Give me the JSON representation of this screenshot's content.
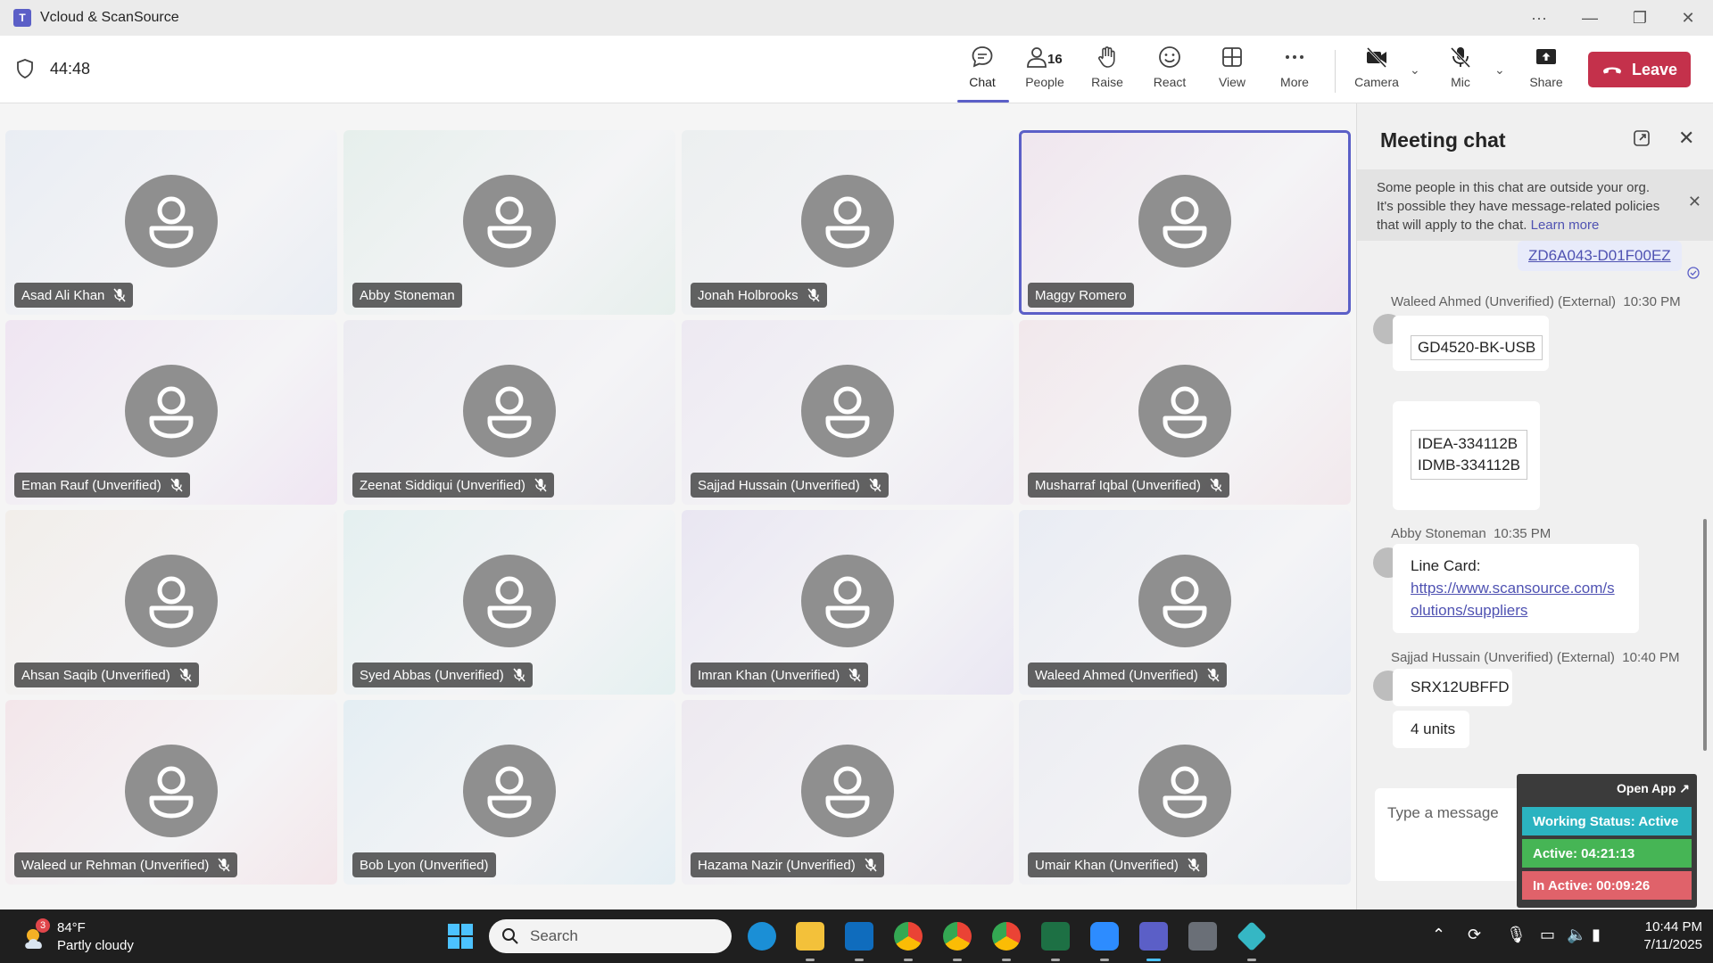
{
  "window": {
    "title": "Vcloud & ScanSource",
    "controls": {
      "more": "···",
      "minimize": "—",
      "restore": "❐",
      "close": "✕"
    }
  },
  "meeting": {
    "timer": "44:48",
    "people_count": "16",
    "toolbar": {
      "chat": "Chat",
      "people": "People",
      "raise": "Raise",
      "react": "React",
      "view": "View",
      "more": "More",
      "camera": "Camera",
      "mic": "Mic",
      "share": "Share",
      "leave": "Leave"
    }
  },
  "participants": [
    {
      "name": "Asad Ali Khan",
      "muted": true,
      "bg": "#e9edf3"
    },
    {
      "name": "Abby Stoneman",
      "muted": false,
      "bg": "#e6efec"
    },
    {
      "name": "Jonah Holbrooks",
      "muted": true,
      "bg": "#eceff0"
    },
    {
      "name": "Maggy Romero",
      "muted": false,
      "bg": "#f0e6ee",
      "active": true
    },
    {
      "name": "Eman Rauf (Unverified)",
      "muted": true,
      "bg": "#efe5f2"
    },
    {
      "name": "Zeenat Siddiqui (Unverified)",
      "muted": true,
      "bg": "#ecebf1"
    },
    {
      "name": "Sajjad Hussain (Unverified)",
      "muted": true,
      "bg": "#ede9f2"
    },
    {
      "name": "Musharraf Iqbal (Unverified)",
      "muted": true,
      "bg": "#f2e8ec"
    },
    {
      "name": "Ahsan Saqib (Unverified)",
      "muted": true,
      "bg": "#f2eeea"
    },
    {
      "name": "Syed Abbas (Unverified)",
      "muted": true,
      "bg": "#e4f0f0"
    },
    {
      "name": "Imran Khan (Unverified)",
      "muted": true,
      "bg": "#e9e6f2"
    },
    {
      "name": "Waleed Ahmed (Unverified)",
      "muted": true,
      "bg": "#e9ecf3"
    },
    {
      "name": "Waleed ur Rehman (Unverified)",
      "muted": true,
      "bg": "#f3e6ea"
    },
    {
      "name": "Bob Lyon (Unverified)",
      "muted": false,
      "bg": "#e4eef3"
    },
    {
      "name": "Hazama Nazir (Unverified)",
      "muted": true,
      "bg": "#ede9f0"
    },
    {
      "name": "Umair Khan (Unverified)",
      "muted": true,
      "bg": "#ecedf2"
    }
  ],
  "chat": {
    "title": "Meeting chat",
    "banner": {
      "text": "Some people in this chat are outside your org. It's possible they have message-related policies that will apply to the chat.",
      "link": "Learn more"
    },
    "my_message": "ZD6A043-D01F00EZ",
    "messages": {
      "m1": {
        "sender": "Waleed Ahmed (Unverified) (External)",
        "time": "10:30 PM",
        "line1": "GD4520-BK-USB",
        "line2": "IDEA-334112B",
        "line3": "IDMB-334112B"
      },
      "m2": {
        "sender": "Abby Stoneman",
        "time": "10:35 PM",
        "text": "Line Card:",
        "link1": "https://www.scansource.com/s",
        "link2": "olutions/suppliers"
      },
      "m3": {
        "sender": "Sajjad Hussain (Unverified) (External)",
        "time": "10:40 PM",
        "line1": "SRX12UBFFD",
        "line2": "4 units"
      }
    },
    "compose_placeholder": "Type a message"
  },
  "widget": {
    "open_app": "Open App ↗",
    "working_status": "Working Status: Active",
    "active": "Active: 04:21:13",
    "inactive": "In Active: 00:09:26",
    "colors": {
      "status": "#2bb3c0",
      "active": "#46b555",
      "inactive": "#e0626a"
    }
  },
  "taskbar": {
    "weather_badge": "3",
    "temperature": "84°F",
    "condition": "Partly cloudy",
    "search": "Search",
    "time": "10:44 PM",
    "date": "7/11/2025"
  },
  "colors": {
    "accent": "#5b5fc7",
    "leave": "#c4314b",
    "link": "#4f52b2"
  }
}
